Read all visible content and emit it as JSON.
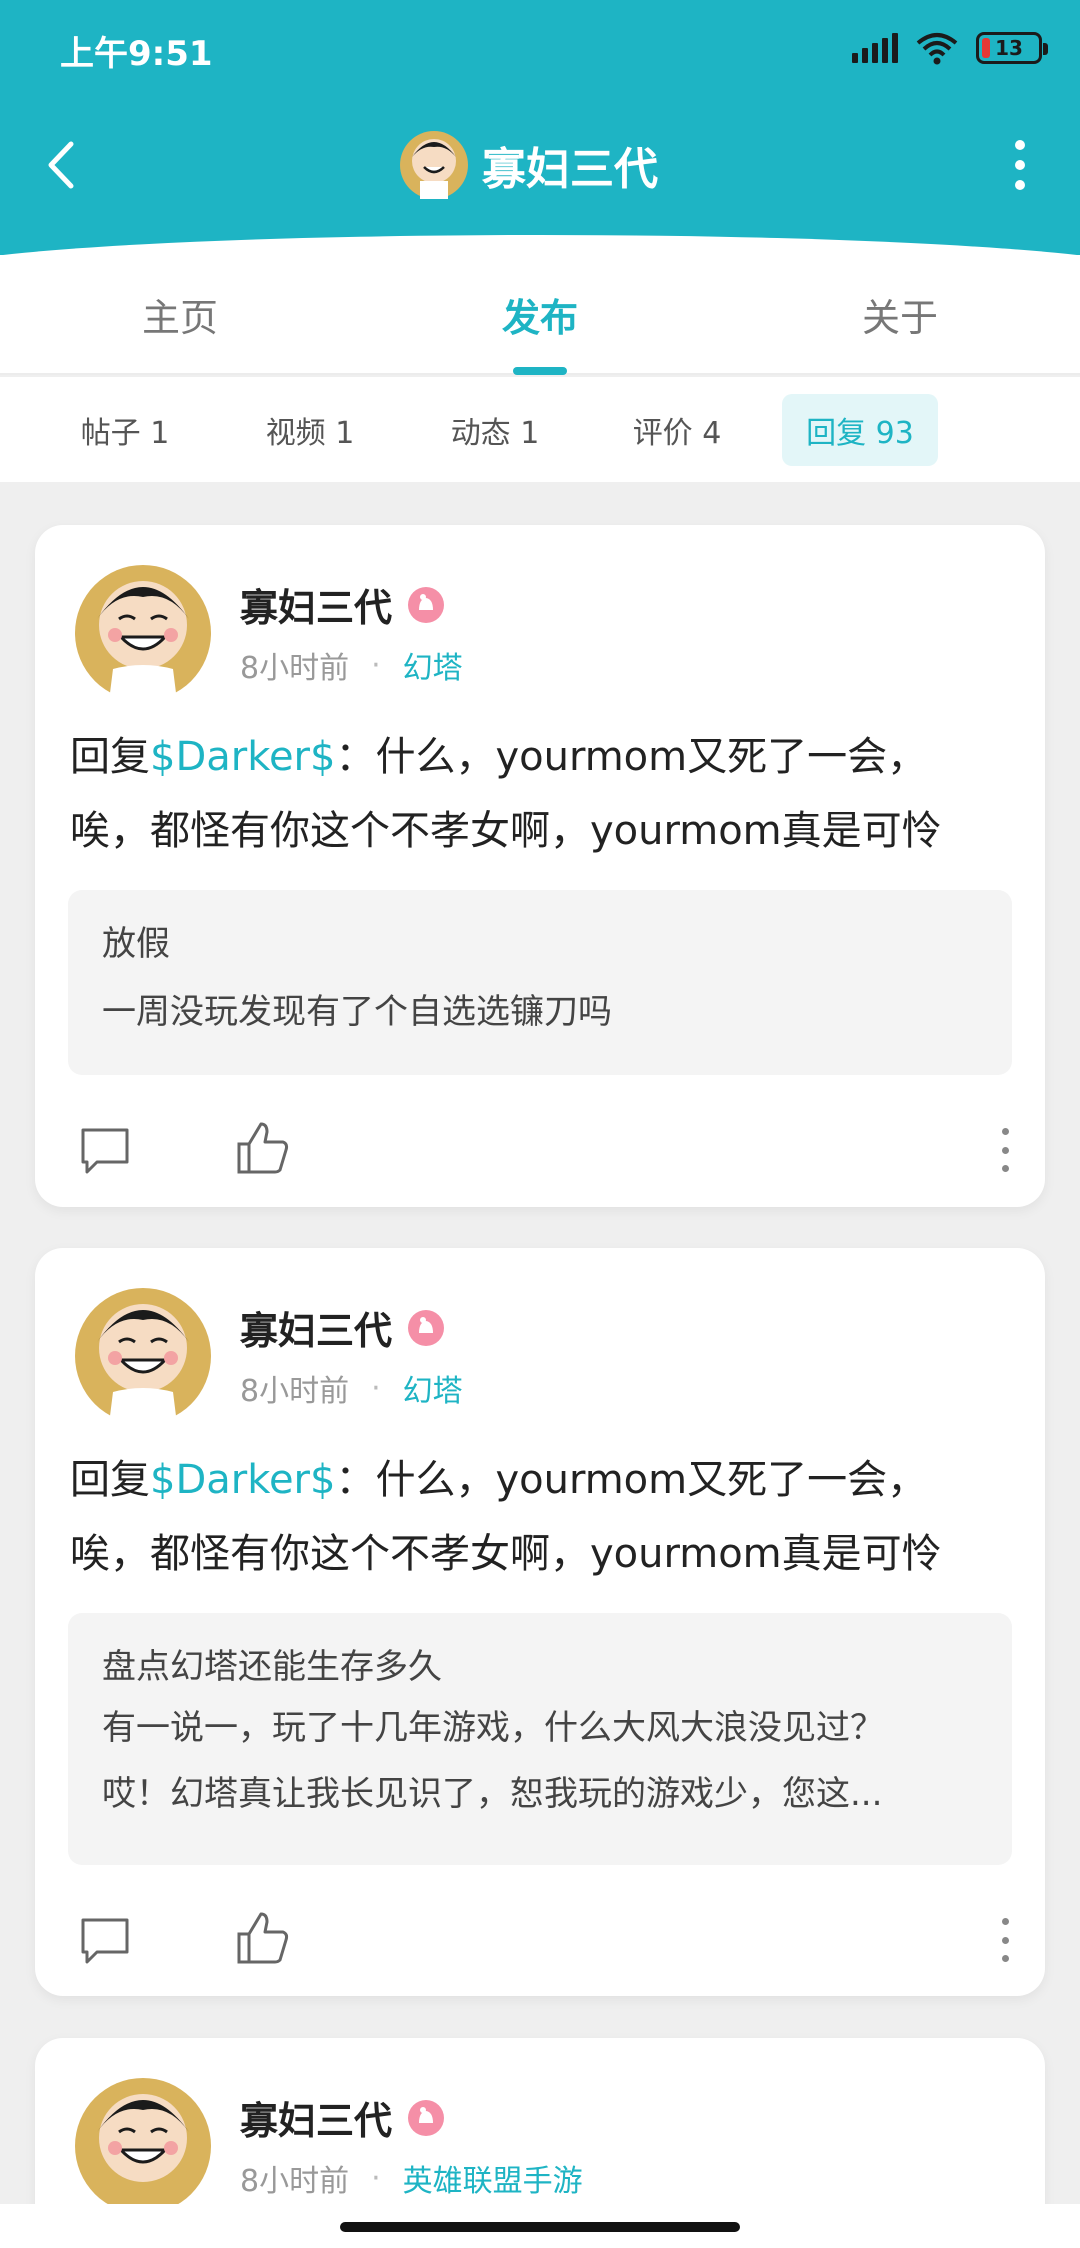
{
  "status_bar": {
    "time": "上午9:51",
    "battery": "13"
  },
  "nav": {
    "title": "寡妇三代"
  },
  "main_tabs": [
    {
      "label": "主页"
    },
    {
      "label": "发布"
    },
    {
      "label": "关于"
    }
  ],
  "sub_tabs": [
    {
      "label": "帖子 1"
    },
    {
      "label": "视频 1"
    },
    {
      "label": "动态 1"
    },
    {
      "label": "评价 4"
    },
    {
      "label": "回复 93"
    }
  ],
  "posts": [
    {
      "username": "寡妇三代",
      "time": "8小时前",
      "tag": "幻塔",
      "reply_prefix": "回复",
      "mention": "$Darker$",
      "text_line1": "：什么，yourmom又死了一会，",
      "text_line2": "唉，都怪有你这个不孝女啊，yourmom真是可怜",
      "quote_title": "放假",
      "quote_lines": [
        "一周没玩发现有了个自选选镰刀吗"
      ]
    },
    {
      "username": "寡妇三代",
      "time": "8小时前",
      "tag": "幻塔",
      "reply_prefix": "回复",
      "mention": "$Darker$",
      "text_line1": "：什么，yourmom又死了一会，",
      "text_line2": "唉，都怪有你这个不孝女啊，yourmom真是可怜",
      "quote_title": "盘点幻塔还能生存多久",
      "quote_lines": [
        "有一说一，玩了十几年游戏，什么大风大浪没见过？",
        "哎！幻塔真让我长见识了，恕我玩的游戏少，您这..."
      ]
    },
    {
      "username": "寡妇三代",
      "time": "8小时前",
      "tag": "英雄联盟手游"
    }
  ],
  "colors": {
    "accent": "#1eb4c4",
    "header_bg": "#1eb4c4",
    "page_bg": "#efefef"
  }
}
